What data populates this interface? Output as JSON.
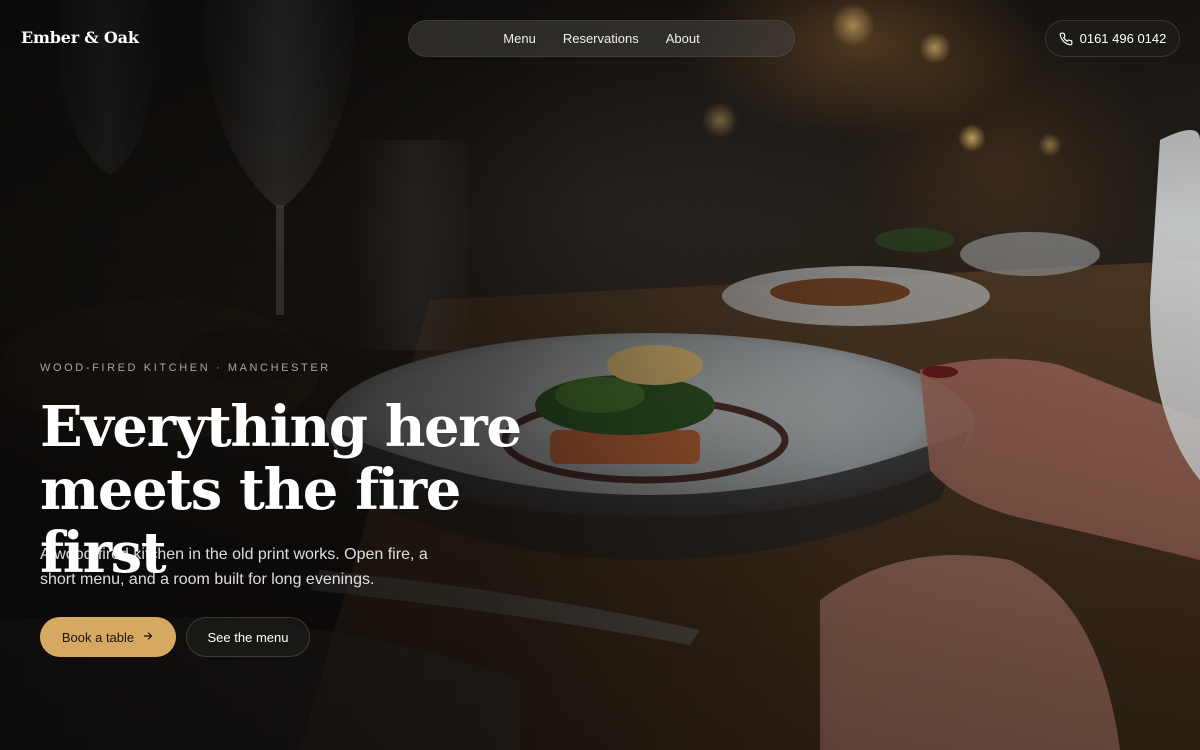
{
  "header": {
    "brand": "Ember & Oak",
    "nav": [
      {
        "label": "Menu"
      },
      {
        "label": "Reservations"
      },
      {
        "label": "About"
      }
    ],
    "phone": {
      "number": "0161 496 0142",
      "icon": "phone-icon"
    }
  },
  "hero": {
    "eyebrow": "WOOD-FIRED KITCHEN · MANCHESTER",
    "headline": [
      "Everything here",
      "meets the fire first"
    ],
    "lede": "A wood-fired kitchen in the old print works. Open fire, a short menu, and a room built for long evenings.",
    "primary_cta": {
      "label": "Book a table",
      "icon": "arrow-right-icon"
    },
    "secondary_cta": {
      "label": "See the menu"
    }
  },
  "colors": {
    "accent": "#d7a862",
    "background": "#0d0b09"
  }
}
